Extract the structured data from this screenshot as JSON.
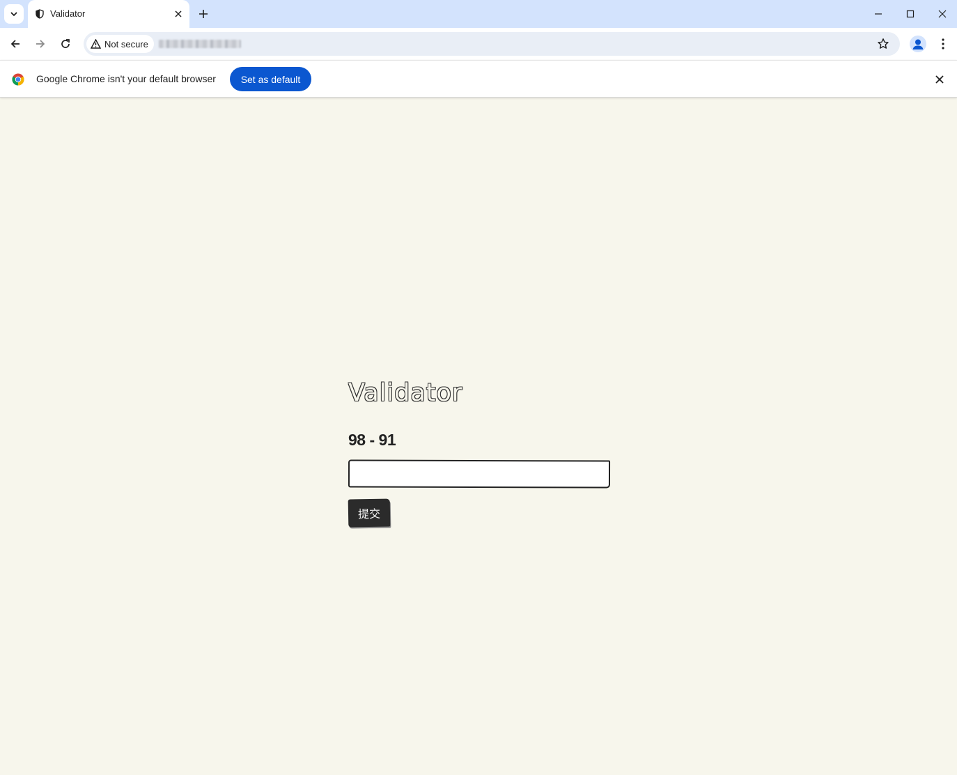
{
  "browser": {
    "tab": {
      "title": "Validator",
      "icon": "shield-icon"
    },
    "address_bar": {
      "security_label": "Not secure",
      "url": ""
    }
  },
  "infobar": {
    "message": "Google Chrome isn't your default browser",
    "button_label": "Set as default"
  },
  "page": {
    "title": "Validator",
    "question": "98 - 91",
    "answer_value": "",
    "submit_label": "提交",
    "background_color": "#f7f6ec"
  },
  "colors": {
    "tabstrip": "#d3e3fd",
    "accent": "#0b57d0",
    "button_dark": "#2b2b2b"
  }
}
